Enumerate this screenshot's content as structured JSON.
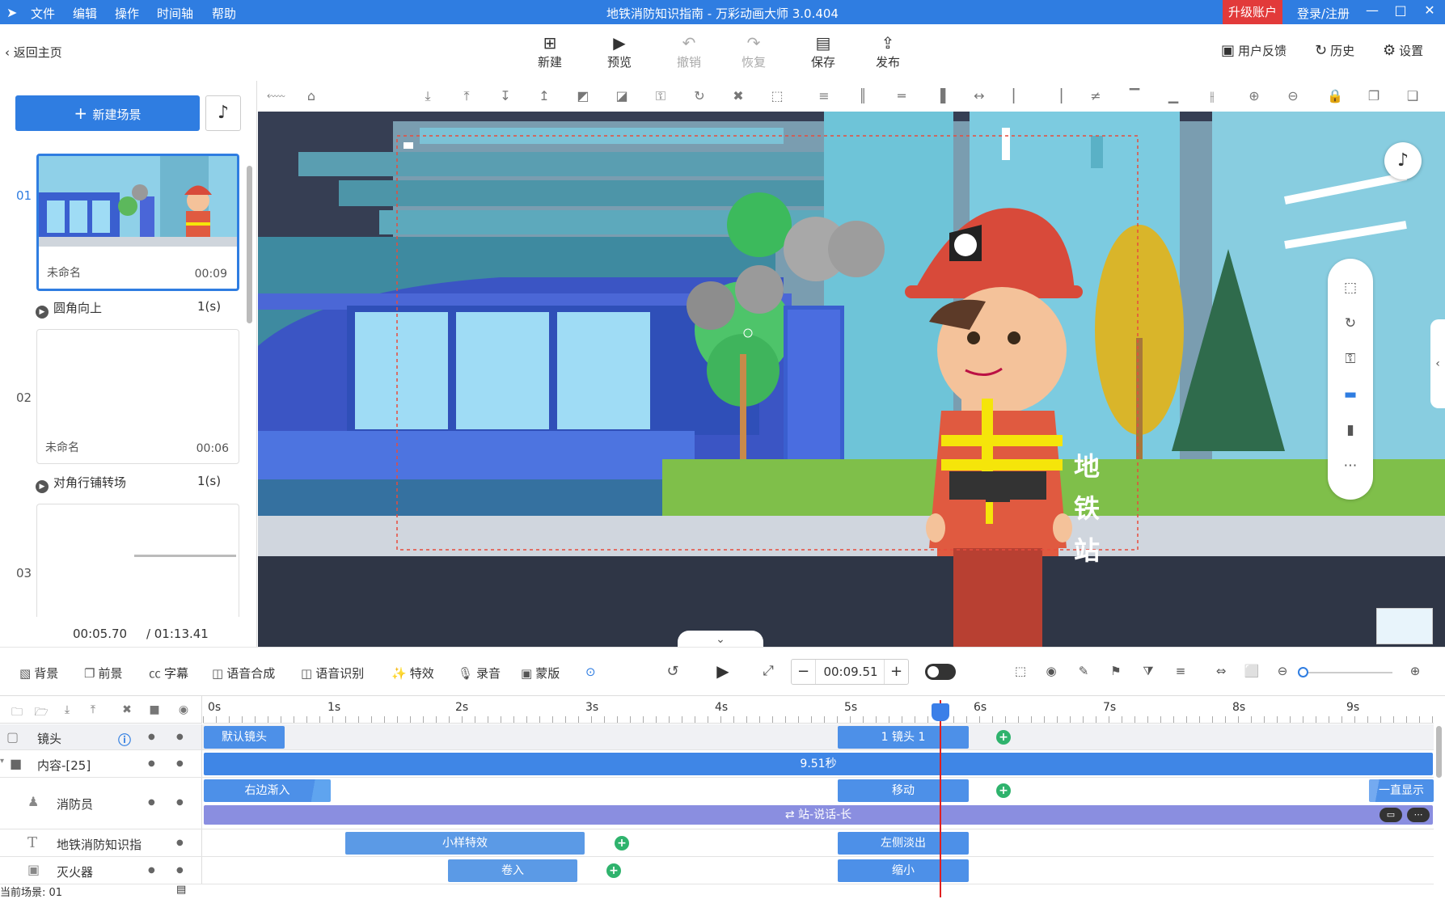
{
  "app": {
    "menu": [
      "文件",
      "编辑",
      "操作",
      "时间轴",
      "帮助"
    ],
    "window_title": "地铁消防知识指南 - 万彩动画大师 3.0.404",
    "upgrade": "升级账户",
    "login": "登录/注册"
  },
  "toolbar": {
    "back": "返回主页",
    "buttons": [
      {
        "label": "新建",
        "icon": "plus-square-icon"
      },
      {
        "label": "预览",
        "icon": "play-icon"
      },
      {
        "label": "撤销",
        "icon": "undo-icon"
      },
      {
        "label": "恢复",
        "icon": "redo-icon"
      },
      {
        "label": "保存",
        "icon": "save-icon"
      },
      {
        "label": "发布",
        "icon": "publish-icon"
      }
    ],
    "feedback": "用户反馈",
    "history": "历史",
    "settings": "设置"
  },
  "scenes": {
    "new_scene": "新建场景",
    "items": [
      {
        "num": "01",
        "name": "未命名",
        "duration": "00:09",
        "transition": "圆角向上",
        "transition_dur": "1(s)"
      },
      {
        "num": "02",
        "name": "未命名",
        "duration": "00:06",
        "transition": "对角行铺转场",
        "transition_dur": "1(s)"
      },
      {
        "num": "03",
        "name": "",
        "duration": "",
        "transition": "",
        "transition_dur": ""
      }
    ],
    "current_time": "00:05.70",
    "total_time": "/ 01:13.41"
  },
  "stage": {
    "sign_chars": [
      "地",
      "铁",
      "站"
    ]
  },
  "funcbar": {
    "items": [
      "背景",
      "前景",
      "字幕",
      "语音合成",
      "语音识别",
      "特效",
      "录音",
      "蒙版"
    ],
    "time": "00:09.51"
  },
  "timeline": {
    "ticks": [
      "0s",
      "1s",
      "2s",
      "3s",
      "4s",
      "5s",
      "6s",
      "7s",
      "8s",
      "9s"
    ],
    "rows": [
      {
        "label": "镜头",
        "blocks": [
          "默认镜头",
          "1 镜头 1"
        ]
      },
      {
        "label": "内容-[25]",
        "blocks": [
          "9.51秒"
        ]
      },
      {
        "label": "消防员",
        "blocks": [
          "右边渐入",
          "移动",
          "一直显示"
        ],
        "sub": "站-说话-长"
      },
      {
        "label": "地铁消防知识指",
        "blocks": [
          "小样特效",
          "左侧淡出"
        ]
      },
      {
        "label": "灭火器",
        "blocks": [
          "卷入",
          "缩小"
        ]
      }
    ],
    "status": "当前场景: 01"
  },
  "colors": {
    "accent": "#2f7de1",
    "upgrade": "#e23a3a",
    "playhead": "#e02020",
    "keyframe": "#2fb36d"
  }
}
